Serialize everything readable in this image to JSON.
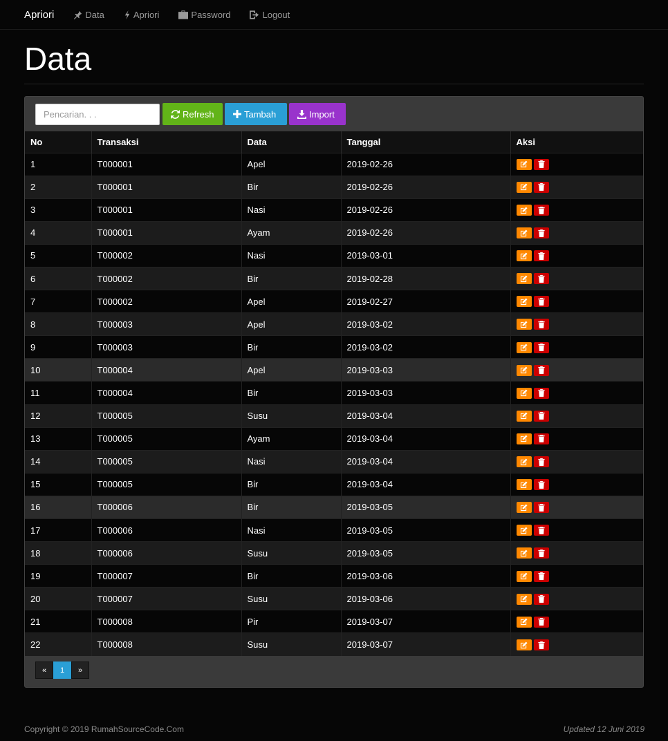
{
  "nav": {
    "brand": "Apriori",
    "items": [
      {
        "label": "Data",
        "icon": "pushpin-icon"
      },
      {
        "label": "Apriori",
        "icon": "flash-icon"
      },
      {
        "label": "Password",
        "icon": "briefcase-icon"
      },
      {
        "label": "Logout",
        "icon": "logout-icon"
      }
    ]
  },
  "page": {
    "title": "Data"
  },
  "toolbar": {
    "search_placeholder": "Pencarian. . .",
    "refresh_label": "Refresh",
    "tambah_label": "Tambah",
    "import_label": "Import"
  },
  "table": {
    "headers": [
      "No",
      "Transaksi",
      "Data",
      "Tanggal",
      "Aksi"
    ],
    "rows": [
      [
        "1",
        "T000001",
        "Apel",
        "2019-02-26"
      ],
      [
        "2",
        "T000001",
        "Bir",
        "2019-02-26"
      ],
      [
        "3",
        "T000001",
        "Nasi",
        "2019-02-26"
      ],
      [
        "4",
        "T000001",
        "Ayam",
        "2019-02-26"
      ],
      [
        "5",
        "T000002",
        "Nasi",
        "2019-03-01"
      ],
      [
        "6",
        "T000002",
        "Bir",
        "2019-02-28"
      ],
      [
        "7",
        "T000002",
        "Apel",
        "2019-02-27"
      ],
      [
        "8",
        "T000003",
        "Apel",
        "2019-03-02"
      ],
      [
        "9",
        "T000003",
        "Bir",
        "2019-03-02"
      ],
      [
        "10",
        "T000004",
        "Apel",
        "2019-03-03"
      ],
      [
        "11",
        "T000004",
        "Bir",
        "2019-03-03"
      ],
      [
        "12",
        "T000005",
        "Susu",
        "2019-03-04"
      ],
      [
        "13",
        "T000005",
        "Ayam",
        "2019-03-04"
      ],
      [
        "14",
        "T000005",
        "Nasi",
        "2019-03-04"
      ],
      [
        "15",
        "T000005",
        "Bir",
        "2019-03-04"
      ],
      [
        "16",
        "T000006",
        "Bir",
        "2019-03-05"
      ],
      [
        "17",
        "T000006",
        "Nasi",
        "2019-03-05"
      ],
      [
        "18",
        "T000006",
        "Susu",
        "2019-03-05"
      ],
      [
        "19",
        "T000007",
        "Bir",
        "2019-03-06"
      ],
      [
        "20",
        "T000007",
        "Susu",
        "2019-03-06"
      ],
      [
        "21",
        "T000008",
        "Pir",
        "2019-03-07"
      ],
      [
        "22",
        "T000008",
        "Susu",
        "2019-03-07"
      ]
    ]
  },
  "pagination": {
    "prev": "«",
    "current": "1",
    "next": "»"
  },
  "footer": {
    "copyright": "Copyright © 2019 RumahSourceCode.Com",
    "updated": "Updated 12 Juni 2019"
  },
  "colors": {
    "refresh": "#62b418",
    "tambah": "#2a9fd6",
    "import": "#9933cc",
    "edit": "#ff8800",
    "delete": "#cc0000"
  }
}
